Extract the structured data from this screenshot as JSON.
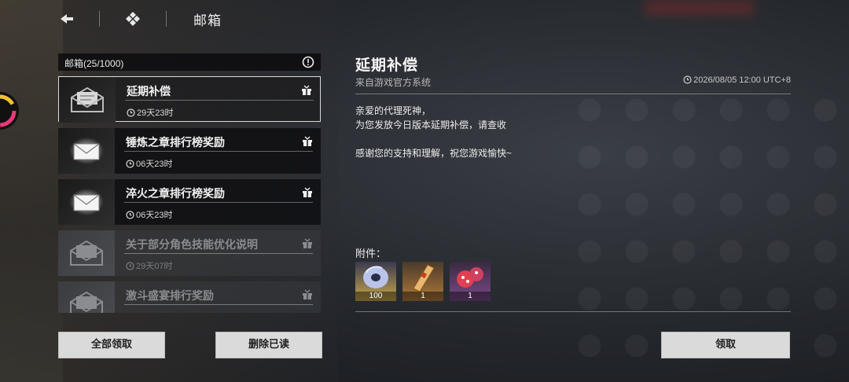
{
  "top": {
    "title": "邮箱"
  },
  "list": {
    "header": "邮箱(25/1000)",
    "items": [
      {
        "title": "延期补偿",
        "time": "29天23时",
        "state": "selected"
      },
      {
        "title": "锤炼之章排行榜奖励",
        "time": "06天23时",
        "state": "unread"
      },
      {
        "title": "淬火之章排行榜奖励",
        "time": "06天23时",
        "state": "unread"
      },
      {
        "title": "关于部分角色技能优化说明",
        "time": "29天07时",
        "state": "read"
      },
      {
        "title": "激斗盛宴排行奖励",
        "time": "",
        "state": "read"
      }
    ]
  },
  "buttons": {
    "claim_all": "全部领取",
    "delete_read": "删除已读",
    "claim": "领取"
  },
  "detail": {
    "title": "延期补偿",
    "sender": "来自游戏官方系统",
    "time": "2026/08/05 12:00 UTC+8",
    "body": [
      "亲爱的代理死神，",
      "为您发放今日版本延期补偿，请查收",
      "",
      "感谢您的支持和理解，祝您游戏愉快~"
    ],
    "attachments_label": "附件：",
    "attachments": [
      {
        "icon": "disc-currency-icon",
        "count": "100",
        "bg": "#c9a84a"
      },
      {
        "icon": "ticket-icon",
        "count": "1",
        "bg": "#b07a3a"
      },
      {
        "icon": "dice-orbs-icon",
        "count": "1",
        "bg": "#7a4a8a"
      }
    ]
  },
  "colors": {
    "button_bg": "#dadada",
    "selected_border": "#dcdcdc"
  }
}
